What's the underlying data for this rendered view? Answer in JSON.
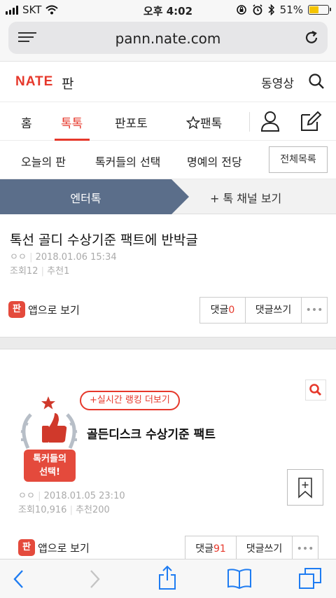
{
  "status_bar": {
    "carrier": "SKT",
    "time": "오후 4:02",
    "battery": "51%",
    "battery_level": 0.51
  },
  "browser": {
    "url": "pann.nate.com"
  },
  "header": {
    "logo": "NATE",
    "logo_sub": "판",
    "video": "동영상"
  },
  "nav": {
    "tabs": [
      "홈",
      "톡톡",
      "판포토",
      "팬톡"
    ],
    "active": "톡톡"
  },
  "subnav": {
    "items": [
      "오늘의 판",
      "톡커들의 선택",
      "명예의 전당"
    ],
    "all_button": "전체목록"
  },
  "category": {
    "name": "엔터톡",
    "channels": "+ 톡 채널 보기"
  },
  "article": {
    "title": "톡선 골디 수상기준 팩트에 반박글",
    "author": "ㅇㅇ",
    "date": "2018.01.06 15:34",
    "views_label": "조회",
    "views": "12",
    "recs_label": "추천",
    "recs": "1",
    "app_view": "앱으로 보기",
    "app_icon": "판",
    "comment_label": "댓글",
    "comment_count": "0",
    "write_comment": "댓글쓰기",
    "more": "•••"
  },
  "card": {
    "rank_more": "+실시간 랭킹 더보기",
    "badge_text_1": "톡커들의",
    "badge_text_2": "선택!",
    "title": "골든디스크 수상기준 팩트",
    "author": "ㅇㅇ",
    "date": "2018.01.05 23:10",
    "views_label": "조회",
    "views": "10,916",
    "recs_label": "추천",
    "recs": "200",
    "app_view": "앱으로 보기",
    "app_icon": "판",
    "comment_label": "댓글",
    "comment_count": "91",
    "write_comment": "댓글쓰기",
    "more": "•••"
  },
  "colors": {
    "accent": "#e6382b",
    "category_bar": "#5b6e8a"
  }
}
